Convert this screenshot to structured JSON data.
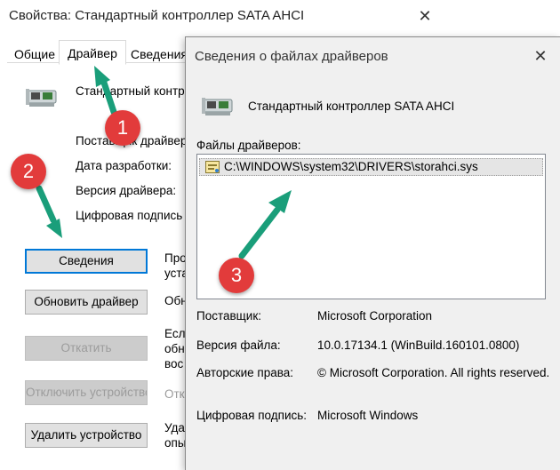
{
  "back_window": {
    "title": "Свойства: Стандартный контроллер SATA AHCI",
    "tabs": [
      "Общие",
      "Драйвер",
      "Сведения"
    ],
    "device_name": "Стандартный контр",
    "properties": [
      {
        "label": "Поставщик драйвера"
      },
      {
        "label": "Дата разработки:"
      },
      {
        "label": "Версия драйвера:"
      },
      {
        "label": "Цифровая подпись"
      }
    ],
    "buttons": {
      "details": "Сведения",
      "update": "Обновить драйвер",
      "rollback": "Откатить",
      "disable": "Отключить устройство",
      "uninstall": "Удалить устройство"
    },
    "side_texts": {
      "details": [
        "Про",
        "уста"
      ],
      "update": [
        "Обн"
      ],
      "rollback": [
        "Есл",
        "обн",
        "вос"
      ],
      "disable": [
        "Отк"
      ],
      "uninstall": [
        "Удал",
        "опы"
      ]
    }
  },
  "front_dialog": {
    "title": "Сведения о файлах драйверов",
    "device_name": "Стандартный контроллер SATA AHCI",
    "files_label": "Файлы драйверов:",
    "files": [
      "C:\\WINDOWS\\system32\\DRIVERS\\storahci.sys"
    ],
    "provider_label": "Поставщик:",
    "provider_value": "Microsoft Corporation",
    "version_label": "Версия файла:",
    "version_value": "10.0.17134.1 (WinBuild.160101.0800)",
    "copyright_label": "Авторские права:",
    "copyright_value": "© Microsoft Corporation. All rights reserved.",
    "signature_label": "Цифровая подпись:",
    "signature_value": "Microsoft Windows"
  },
  "annotations": {
    "badges": [
      "1",
      "2",
      "3"
    ],
    "accent_color": "#e23b3b",
    "arrow_color": "#1a9e7a"
  },
  "icons": [
    "close-icon",
    "controller-device-icon",
    "driver-file-icon"
  ]
}
